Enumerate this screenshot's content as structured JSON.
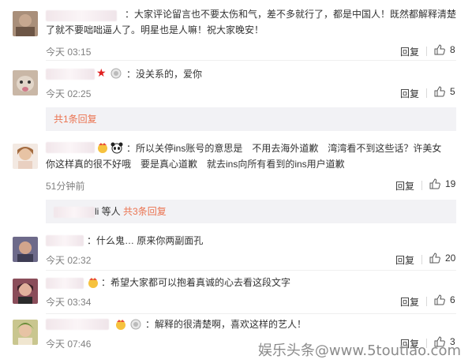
{
  "comments": [
    {
      "text": "：大家评论留言也不要太伤和气，差不多就行了，都是中国人！既然都解释清楚了就不要咄咄逼人了。明星也是人嘛！祝大家晚安！",
      "time": "今天 03:15",
      "reply_label": "回复",
      "likes": "8"
    },
    {
      "text": "：没关系的，爱你",
      "time": "今天 02:25",
      "reply_label": "回复",
      "likes": "5",
      "replies_link": "共1条回复"
    },
    {
      "text": "：所以关停ins账号的意思是　不用去海外道歉　湾湾看不到这些话？许美女　你这样真的很不好哦　要是真心道歉　就去ins向所有看到的ins用户道歉",
      "time": "51分钟前",
      "reply_label": "回复",
      "likes": "19",
      "replies_prefix": "li 等人",
      "replies_link": "共3条回复"
    },
    {
      "text": "：什么鬼… 原来你两副面孔",
      "time": "今天 02:32",
      "reply_label": "回复",
      "likes": "20"
    },
    {
      "text": "：希望大家都可以抱着真诚的心去看这段文字",
      "time": "今天 03:34",
      "reply_label": "回复",
      "likes": "6"
    },
    {
      "text": "：解释的很清楚啊，喜欢这样的艺人！",
      "time": "今天 07:46",
      "reply_label": "回复",
      "likes": "3"
    }
  ],
  "watermark": "娱乐头条@www.5toutiao.com",
  "colors": {
    "accent": "#eb7350",
    "time": "#808080",
    "subbar_bg": "#f2f2f5"
  }
}
